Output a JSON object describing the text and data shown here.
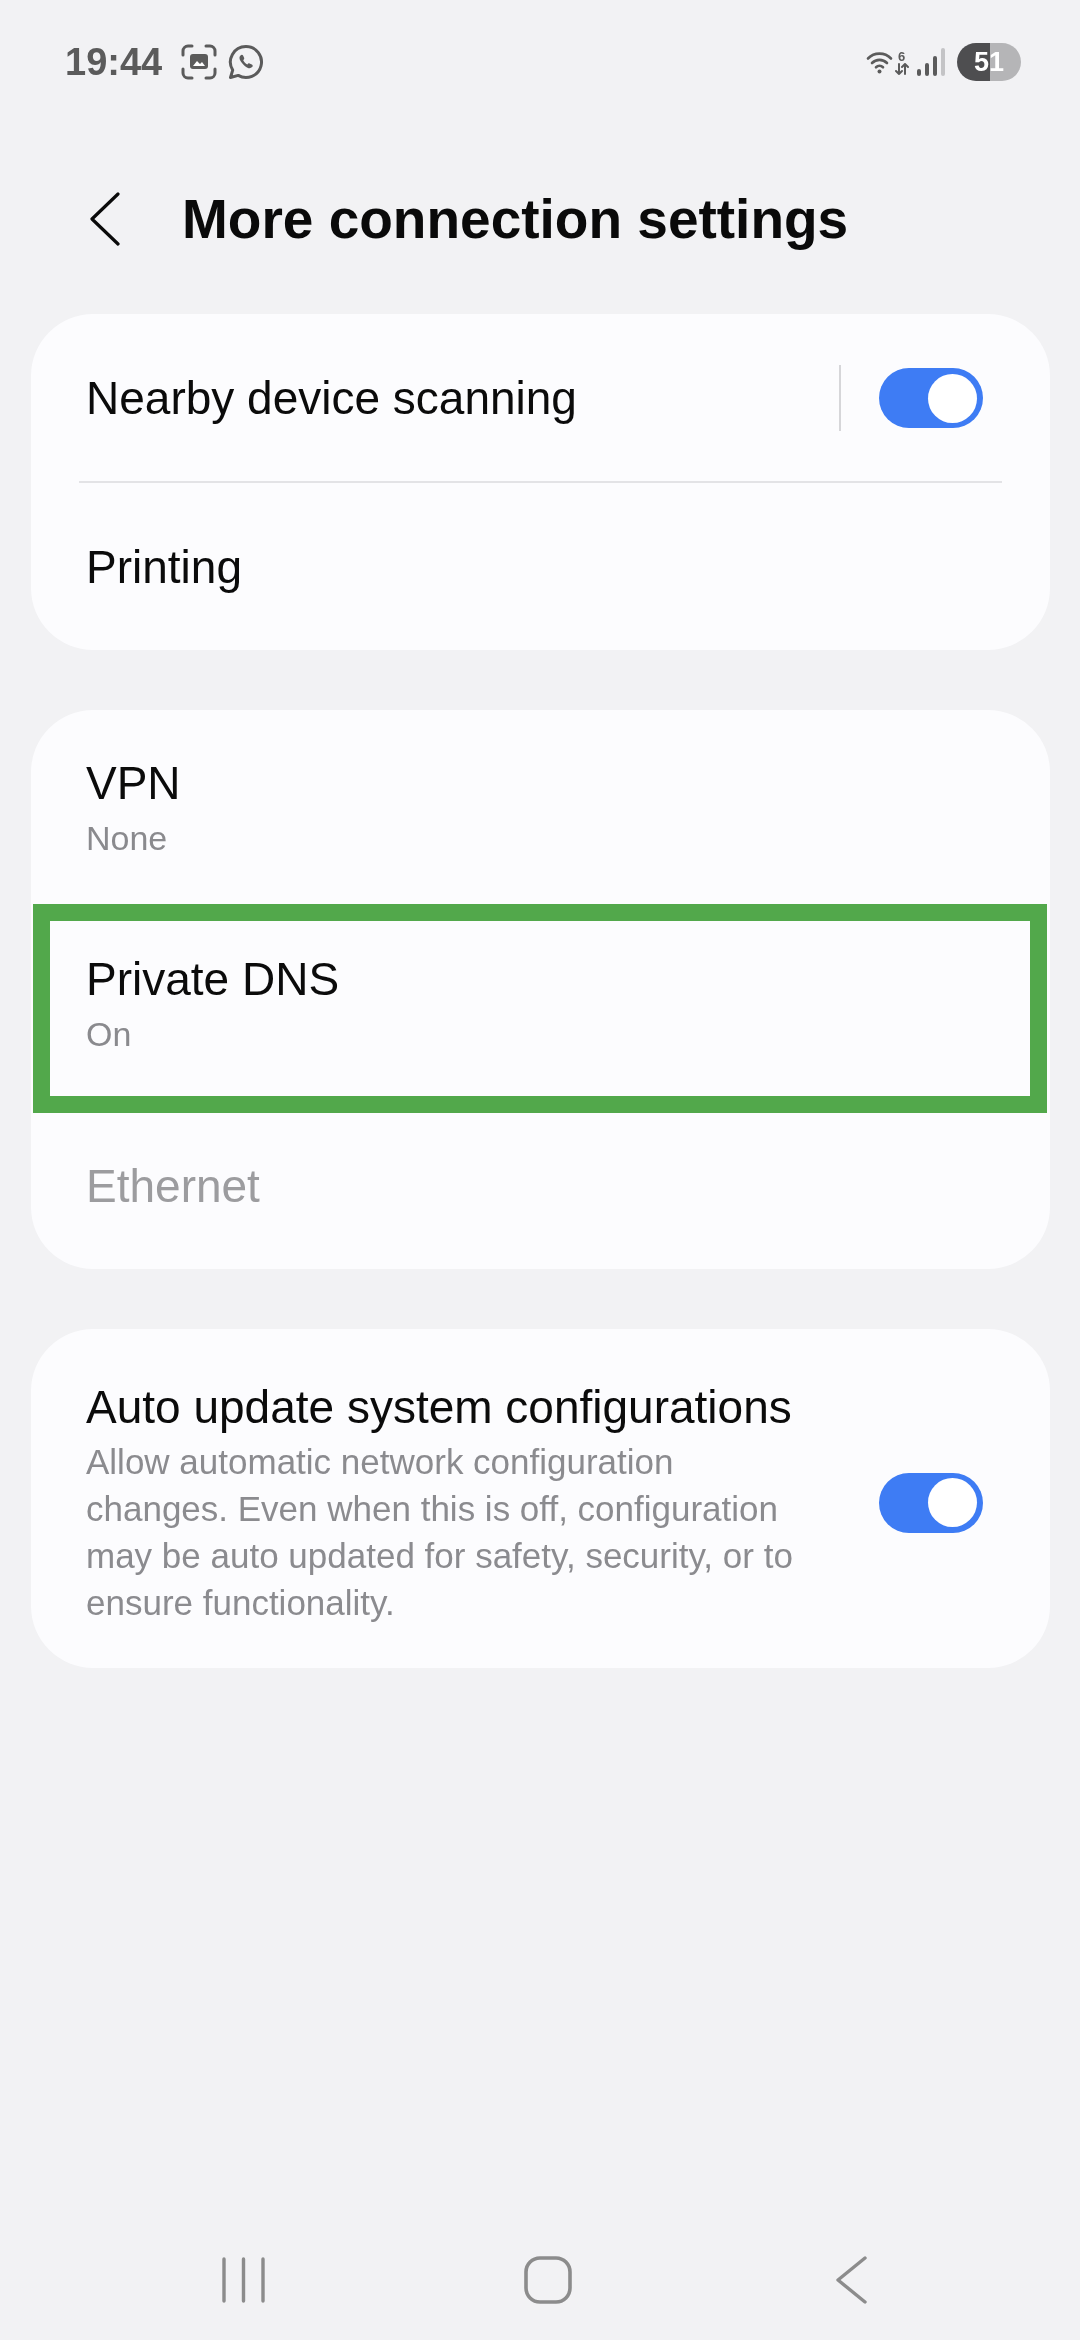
{
  "status_bar": {
    "time": "19:44",
    "wifi_label": "6",
    "battery": "51"
  },
  "header": {
    "title": "More connection settings"
  },
  "cards": [
    {
      "dividers": true,
      "items": [
        {
          "kind": "split_switch",
          "title": "Nearby device scanning",
          "on": true
        },
        {
          "kind": "link",
          "title": "Printing"
        }
      ]
    },
    {
      "dividers": false,
      "items": [
        {
          "kind": "link",
          "title": "VPN",
          "subtitle": "None",
          "disabled": false,
          "highlighted": false
        },
        {
          "kind": "link",
          "title": "Private DNS",
          "subtitle": "On",
          "disabled": false,
          "highlighted": true
        },
        {
          "kind": "link",
          "title": "Ethernet",
          "disabled": true,
          "highlighted": false
        }
      ]
    },
    {
      "items": [
        {
          "kind": "switch",
          "title": "Auto update system configurations",
          "description": "Allow automatic network configuration changes. Even when this is off, configuration may be auto updated for safety, security, or to ensure functionality.",
          "on": true
        }
      ]
    }
  ]
}
